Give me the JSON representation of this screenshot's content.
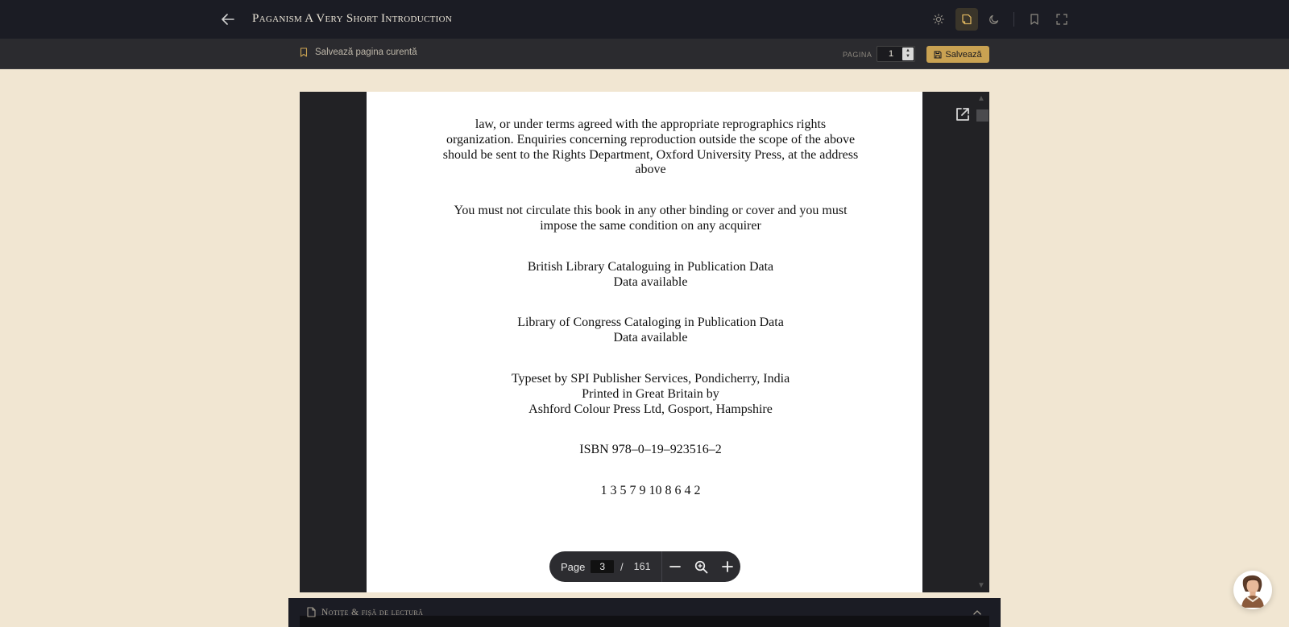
{
  "header": {
    "title": "Paganism A Very Short Introduction",
    "icons": [
      "arrow-left-icon",
      "sun-icon",
      "book-open-icon",
      "moon-icon",
      "bookmark-icon",
      "fullscreen-icon"
    ]
  },
  "subbar": {
    "save_page_label": "Salvează pagina curentă",
    "page_label": "PAGINA",
    "page_value": "1",
    "save_button": "Salvează"
  },
  "document": {
    "paragraphs": [
      [
        "law, or under terms agreed with the appropriate reprographics rights",
        "organization. Enquiries concerning reproduction outside the scope of the above",
        "should be sent to the Rights Department, Oxford University Press, at the address",
        "above"
      ],
      [
        "You must not circulate this book in any other binding or cover and you must",
        "impose the same condition on any acquirer"
      ],
      [
        "British Library Cataloguing in Publication Data",
        "Data available"
      ],
      [
        "Library of Congress Cataloging in Publication Data",
        "Data available"
      ],
      [
        "Typeset by SPI Publisher Services, Pondicherry, India",
        "Printed in Great Britain by",
        "Ashford Colour Press Ltd, Gosport, Hampshire"
      ],
      [
        "ISBN 978–0–19–923516–2"
      ],
      [
        "1 3 5 7 9 10 8 6 4 2"
      ]
    ]
  },
  "pager": {
    "label": "Page",
    "current": "3",
    "separator": "/",
    "total": "161"
  },
  "notes": {
    "title": "Notițe & fișă de lectură"
  },
  "colors": {
    "accent": "#c9a252",
    "background": "#f1e6d2",
    "topbar": "#1b1c24"
  }
}
